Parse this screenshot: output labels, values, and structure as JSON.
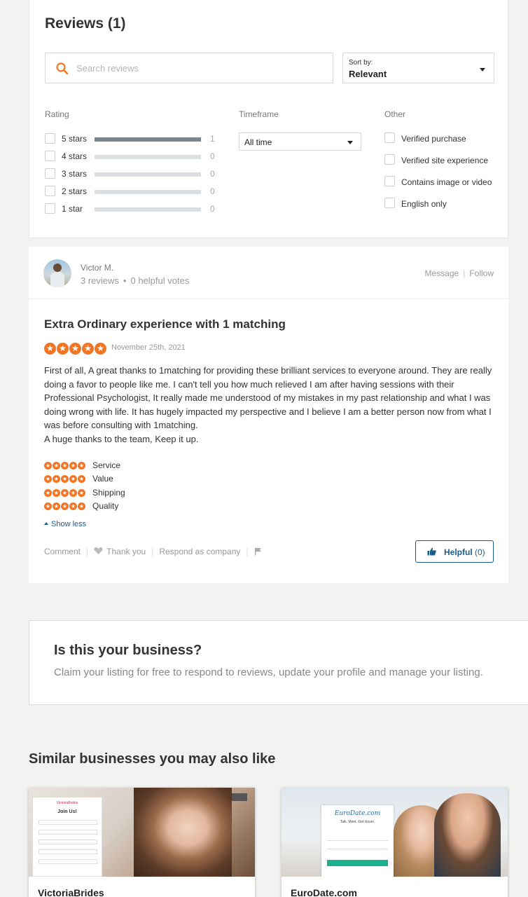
{
  "reviews": {
    "title": "Reviews (1)",
    "search_placeholder": "Search reviews",
    "sort_label": "Sort by:",
    "sort_value": "Relevant",
    "filters": {
      "rating_heading": "Rating",
      "timeframe_heading": "Timeframe",
      "other_heading": "Other",
      "ratings": [
        {
          "label": "5 stars",
          "count": "1",
          "fraction": 1.0
        },
        {
          "label": "4 stars",
          "count": "0",
          "fraction": 0
        },
        {
          "label": "3 stars",
          "count": "0",
          "fraction": 0
        },
        {
          "label": "2 stars",
          "count": "0",
          "fraction": 0
        },
        {
          "label": "1 star",
          "count": "0",
          "fraction": 0
        }
      ],
      "timeframe_value": "All time",
      "other": [
        "Verified purchase",
        "Verified site experience",
        "Contains image or video",
        "English only"
      ]
    }
  },
  "review": {
    "reviewer_name": "Victor M.",
    "reviewer_reviews": "3 reviews",
    "reviewer_votes": "0 helpful votes",
    "message_label": "Message",
    "follow_label": "Follow",
    "title": "Extra Ordinary experience with 1 matching",
    "stars": 5,
    "date": "November 25th, 2021",
    "body_paragraph_1": "First of all, A great thanks to 1matching for providing these brilliant services to everyone around. They are really doing a favor to people like me. I can't tell you how much relieved I am after having sessions with their Professional Psychologist, It really made me understood of my mistakes in my past relationship and what I was doing wrong with life. It has hugely impacted my perspective and I believe I am a better person now from what I was before consulting with 1matching.",
    "body_paragraph_2": "A huge thanks to the team, Keep it up.",
    "sub_ratings": [
      {
        "label": "Service",
        "stars": 5
      },
      {
        "label": "Value",
        "stars": 5
      },
      {
        "label": "Shipping",
        "stars": 5
      },
      {
        "label": "Quality",
        "stars": 5
      }
    ],
    "show_less": "Show less",
    "comment_label": "Comment",
    "thank_you_label": "Thank you",
    "respond_label": "Respond as company",
    "helpful_label": "Helpful",
    "helpful_count": "(0)"
  },
  "business": {
    "title": "Is this your business?",
    "text": "Claim your listing for free to respond to reviews, update your profile and manage your listing."
  },
  "similar": {
    "title": "Similar businesses you may also like",
    "items": [
      {
        "name": "VictoriaBrides",
        "form_title": "Join Us!"
      },
      {
        "name": "EuroDate.com",
        "form_logo": "EuroDate.com",
        "form_tagline": "Talk. Meet. Get closer."
      }
    ]
  },
  "colors": {
    "accent_orange": "#f27523",
    "link_blue": "#1a5e8e",
    "bar_fill": "#7d868d"
  },
  "icons": [
    "search-icon",
    "chevron-down-icon",
    "star-icon",
    "heart-icon",
    "flag-icon",
    "thumbs-up-icon",
    "caret-up-icon"
  ]
}
